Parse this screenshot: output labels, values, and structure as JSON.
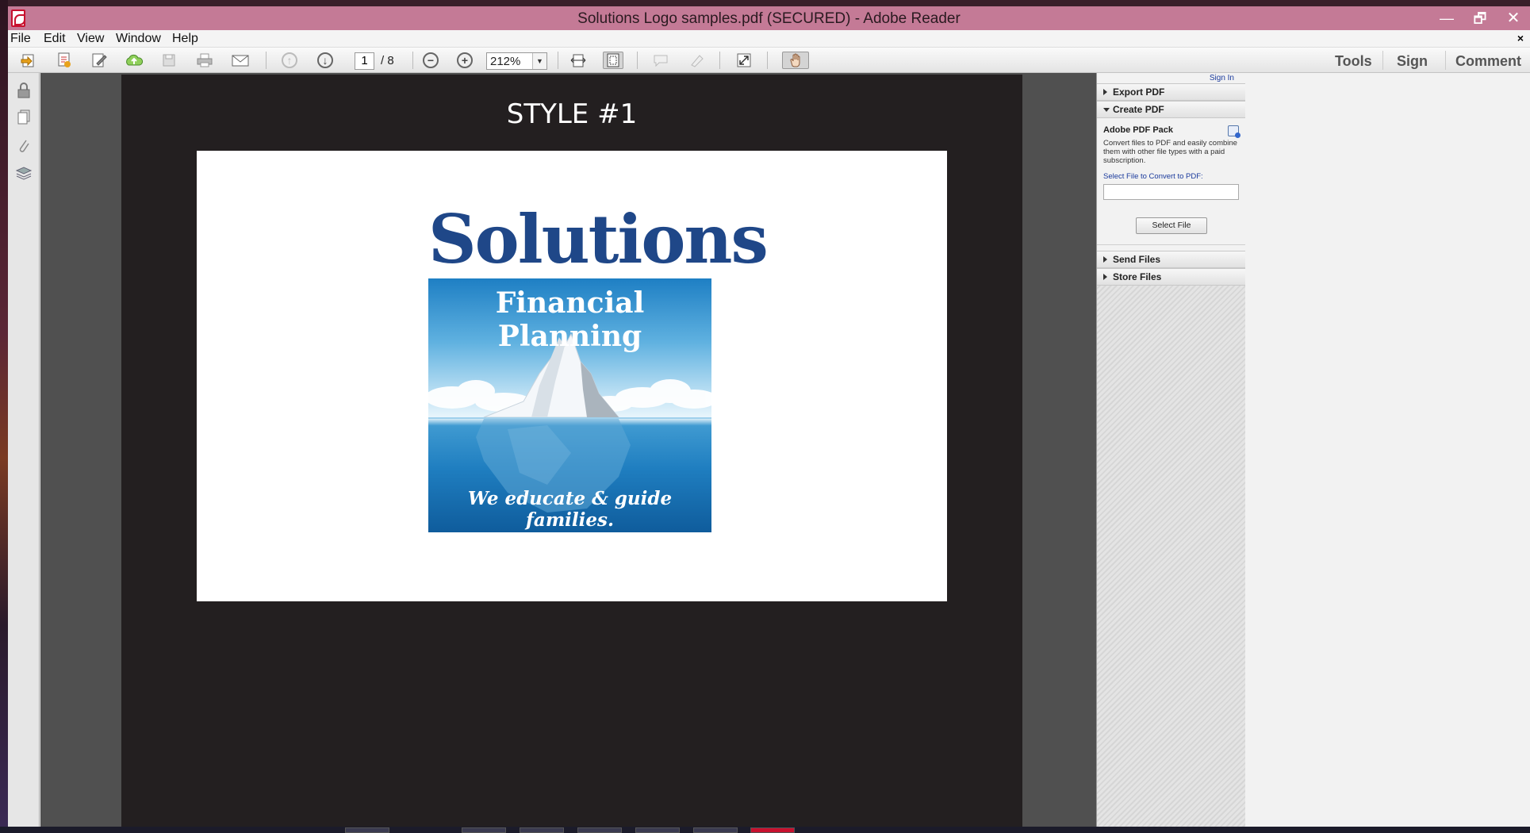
{
  "window": {
    "title": "Solutions Logo samples.pdf (SECURED) - Adobe Reader",
    "minimize_glyph": "—",
    "maximize_glyph": "🗗",
    "close_glyph": "✕"
  },
  "menu": {
    "items": [
      "File",
      "Edit",
      "View",
      "Window",
      "Help"
    ],
    "close_glyph": "×"
  },
  "toolbar": {
    "current_page": "1",
    "page_total": "/ 8",
    "zoom": "212%",
    "right": {
      "tools": "Tools",
      "sign": "Sign",
      "comment": "Comment"
    }
  },
  "document": {
    "heading": "STYLE #1",
    "logo_word": "Solutions",
    "logo_subtitle": "Financial Planning",
    "logo_tagline": "We educate & guide families."
  },
  "right_pane": {
    "sign_in": "Sign In",
    "sections": [
      {
        "label": "Export PDF",
        "expanded": false
      },
      {
        "label": "Create PDF",
        "expanded": true
      },
      {
        "label": "Send Files",
        "expanded": false
      },
      {
        "label": "Store Files",
        "expanded": false
      }
    ],
    "pack_title": "Adobe PDF Pack",
    "pack_description": "Convert files to PDF and easily combine them with other file types with a paid subscription.",
    "select_label": "Select File to Convert to PDF:",
    "select_button": "Select File"
  },
  "colors": {
    "titlebar": "#c47a96",
    "logo_blue": "#1f4788",
    "link_blue": "#1a3a9c",
    "page_bg": "#231f20"
  }
}
